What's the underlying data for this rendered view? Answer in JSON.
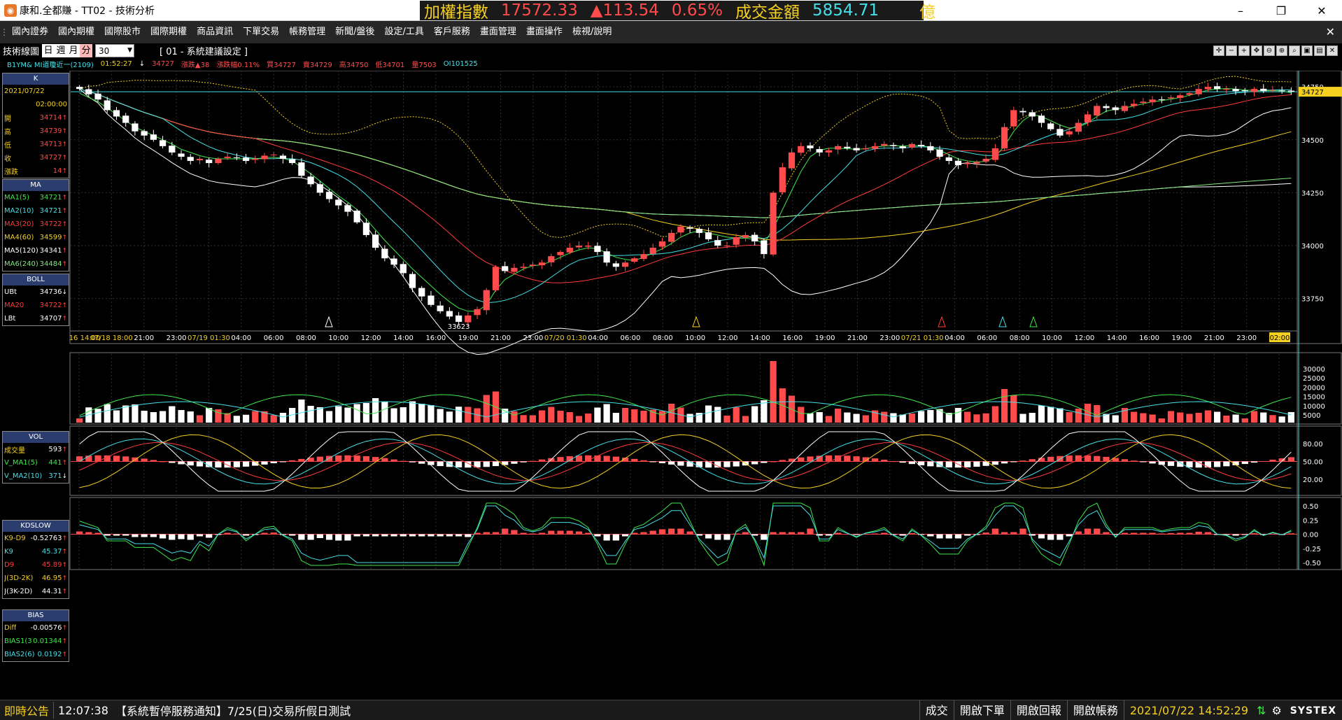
{
  "window": {
    "title": "康和.全都賺 - TT02 - 技術分析",
    "minimize": "–",
    "maximize": "❐",
    "close": "✕"
  },
  "ticker": {
    "label1": "加權指數",
    "index": "17572.33",
    "change": "▲113.54",
    "pct": "0.65%",
    "label2": "成交金額",
    "turnover": "5854.71",
    "unit": "億"
  },
  "menu": [
    "國內證券",
    "國內期權",
    "國際股市",
    "國際期權",
    "商品資訊",
    "下單交易",
    "帳務管理",
    "新聞/盤後",
    "設定/工具",
    "客戶服務",
    "畫面管理",
    "畫面操作",
    "檢視/說明"
  ],
  "toolbar": {
    "title": "技術線圖",
    "periods": [
      "日",
      "週",
      "月",
      "分"
    ],
    "active_period": "分",
    "interval": "30",
    "setting": "[ 01 - 系統建議設定 ]"
  },
  "quote": {
    "symbol": "B1YM& MI道瓊近一(2109)",
    "time": "01:52:27",
    "dir": "↓",
    "last": "34727",
    "change": "漲跌▲38",
    "pct": "漲跌幅0.11%",
    "bid": "買34727",
    "ask": "賣34729",
    "high": "高34750",
    "low": "低34701",
    "volume": "量7503",
    "oi": "OI101525"
  },
  "panel": {
    "k": {
      "header": "K",
      "date": "2021/07/22",
      "time": "02:00:00",
      "rows": [
        {
          "label": "開",
          "value": "34714"
        },
        {
          "label": "高",
          "value": "34739"
        },
        {
          "label": "低",
          "value": "34713"
        },
        {
          "label": "收",
          "value": "34727"
        },
        {
          "label": "漲跌",
          "value": "14"
        }
      ]
    },
    "ma": {
      "header": "MA",
      "rows": [
        {
          "label": "MA1(5)",
          "value": "34721",
          "color": "#3ee84a"
        },
        {
          "label": "MA2(10)",
          "value": "34721",
          "color": "#44e0e8"
        },
        {
          "label": "MA3(20)",
          "value": "34722",
          "color": "#ff3b3b"
        },
        {
          "label": "MA4(60)",
          "value": "34599",
          "color": "#f5d020"
        },
        {
          "label": "MA5(120)",
          "value": "34341",
          "color": "#ffffff"
        },
        {
          "label": "MA6(240)",
          "value": "34484",
          "color": "#7fe87f"
        }
      ]
    },
    "boll": {
      "header": "BOLL",
      "rows": [
        {
          "label": "UBt",
          "value": "34736"
        },
        {
          "label": "MA20",
          "value": "34722"
        },
        {
          "label": "LBt",
          "value": "34707"
        }
      ]
    },
    "vol": {
      "header": "VOL",
      "rows": [
        {
          "label": "成交量",
          "value": "593"
        },
        {
          "label": "V_MA1(5)",
          "value": "441"
        },
        {
          "label": "V_MA2(10)",
          "value": "371"
        }
      ]
    },
    "kd": {
      "header": "KDSLOW",
      "rows": [
        {
          "label": "K9-D9",
          "value": "-0.52763"
        },
        {
          "label": "K9",
          "value": "45.37"
        },
        {
          "label": "D9",
          "value": "45.89"
        },
        {
          "label": "J(3D-2K)",
          "value": "46.95"
        },
        {
          "label": "J(3K-2D)",
          "value": "44.31"
        }
      ]
    },
    "bias": {
      "header": "BIAS",
      "rows": [
        {
          "label": "Diff",
          "value": "-0.00576"
        },
        {
          "label": "BIAS1(3)",
          "value": "0.01344"
        },
        {
          "label": "BIAS2(6)",
          "value": "0.0192"
        }
      ]
    }
  },
  "chart_data": {
    "type": "candlestick",
    "price_axis": [
      "34750",
      "34500",
      "34250",
      "34000",
      "33750"
    ],
    "price_range": [
      33620,
      34800
    ],
    "last_price_tag": "34727",
    "low_marker": "33623",
    "time_labels": [
      "07/16 14:00",
      "07/18 18:00",
      "21:00",
      "23:00",
      "07/19 01:30",
      "04:00",
      "06:00",
      "08:00",
      "10:00",
      "12:00",
      "14:00",
      "16:00",
      "19:00",
      "21:00",
      "23:00",
      "07/20 01:30",
      "04:00",
      "06:00",
      "08:00",
      "10:00",
      "12:00",
      "14:00",
      "16:00",
      "19:00",
      "21:00",
      "23:00",
      "07/21 01:30",
      "04:00",
      "06:00",
      "08:00",
      "10:00",
      "12:00",
      "14:00",
      "16:00",
      "19:00",
      "21:00",
      "23:00",
      "02:00"
    ],
    "closes": [
      34740,
      34715,
      34690,
      34640,
      34610,
      34580,
      34540,
      34520,
      34500,
      34470,
      34440,
      34420,
      34400,
      34410,
      34390,
      34410,
      34420,
      34415,
      34400,
      34410,
      34425,
      34430,
      34410,
      34390,
      34330,
      34290,
      34250,
      34220,
      34190,
      34160,
      34110,
      34050,
      33990,
      33940,
      33910,
      33870,
      33800,
      33760,
      33720,
      33690,
      33665,
      33640,
      33670,
      33700,
      33790,
      33900,
      33880,
      33895,
      33900,
      33910,
      33920,
      33950,
      33970,
      33990,
      34000,
      34000,
      33970,
      33920,
      33900,
      33920,
      33940,
      33960,
      33990,
      34020,
      34060,
      34090,
      34080,
      34060,
      34030,
      34000,
      34000,
      34040,
      34050,
      34020,
      33960,
      34250,
      34370,
      34440,
      34470,
      34460,
      34440,
      34450,
      34470,
      34460,
      34450,
      34460,
      34470,
      34480,
      34470,
      34460,
      34480,
      34470,
      34450,
      34420,
      34400,
      34380,
      34390,
      34395,
      34410,
      34460,
      34560,
      34640,
      34630,
      34610,
      34580,
      34550,
      34520,
      34540,
      34580,
      34620,
      34660,
      34650,
      34640,
      34660,
      34670,
      34680,
      34690,
      34690,
      34700,
      34710,
      34720,
      34740,
      34750,
      34740,
      34740,
      34730,
      34730,
      34740,
      34730,
      34735,
      34730,
      34727
    ],
    "ma5": [
      34720,
      34700,
      34680,
      34650,
      34620,
      34590,
      34560,
      34540,
      34520,
      34500,
      34480,
      34455,
      34440,
      34425,
      34415,
      34410,
      34410,
      34410,
      34410,
      34410,
      34415,
      34418,
      34412,
      34400,
      34370,
      34340,
      34305,
      34270,
      34235,
      34205,
      34170,
      34125,
      34075,
      34025,
      33980,
      33935,
      33890,
      33850,
      33810,
      33770,
      33735,
      33705,
      33690,
      33690,
      33720,
      33790,
      33840,
      33865,
      33890,
      33905,
      33910,
      33925,
      33945,
      33965,
      33980,
      33990,
      33985,
      33965,
      33945,
      33935,
      33930,
      33945,
      33965,
      33985,
      34010,
      34040,
      34060,
      34070,
      34060,
      34050,
      34040,
      34035,
      34035,
      34030,
      34010,
      34080,
      34170,
      34260,
      34350,
      34420,
      34450,
      34460,
      34460,
      34458,
      34455,
      34458,
      34465,
      34470,
      34472,
      34470,
      34472,
      34472,
      34465,
      34450,
      34430,
      34410,
      34400,
      34395,
      34398,
      34420,
      34470,
      34540,
      34590,
      34620,
      34610,
      34590,
      34570,
      34555,
      34560,
      34580,
      34610,
      34635,
      34645,
      34650,
      34660,
      34670,
      34680,
      34685,
      34692,
      34700,
      34710,
      34722,
      34735,
      34740,
      34742,
      34740,
      34735,
      34733,
      34732,
      34732,
      34731,
      34721
    ]
  },
  "volume_axis": [
    "30000",
    "25000",
    "20000",
    "15000",
    "10000",
    "5000"
  ],
  "kd_axis": [
    "80.00",
    "50.00",
    "20.00"
  ],
  "bias_axis": [
    "0.50",
    "0.25",
    "0.00",
    "-0.25",
    "-0.50"
  ],
  "status": {
    "announce_label": "即時公告",
    "announce_time": "12:07:38",
    "announce_text": "【系統暫停服務通知】7/25(日)交易所假日測試",
    "buttons": [
      "成交",
      "開啟下單",
      "開啟回報",
      "開啟帳務"
    ],
    "clock": "2021/07/22 14:52:29",
    "brand": "SYSTEX"
  },
  "colors": {
    "up": "#ff4b4b",
    "down": "#ffffff",
    "grid": "#3a3a3a",
    "accent": "#f5d020",
    "panel_header": "#2a3d6e"
  }
}
